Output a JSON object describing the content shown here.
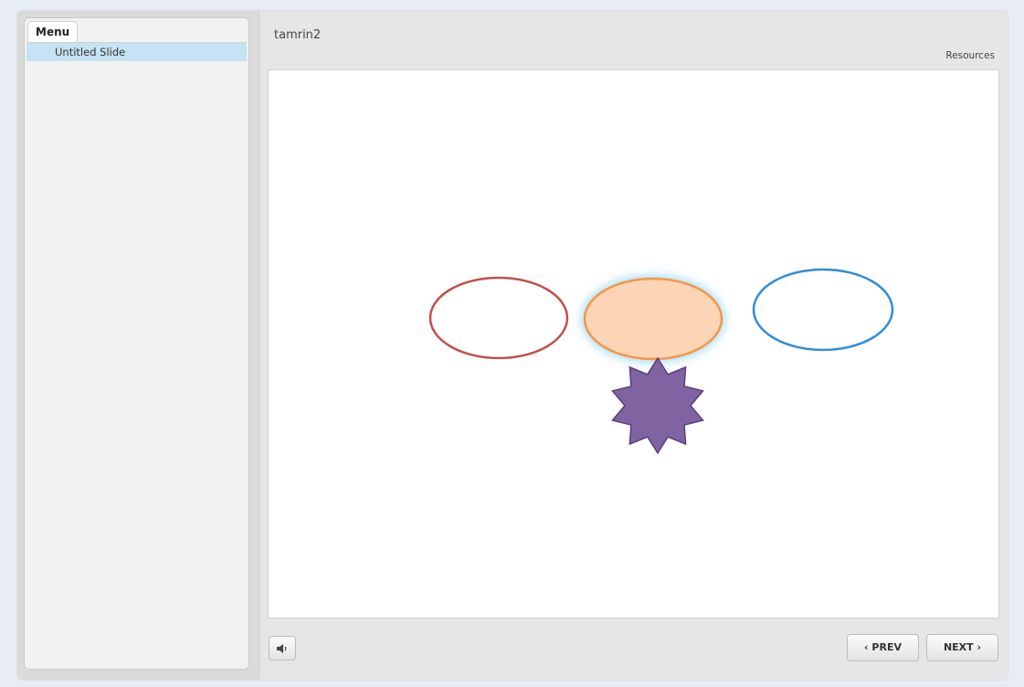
{
  "sidebar": {
    "tab_label": "Menu",
    "items": [
      {
        "label": "Untitled Slide",
        "selected": true
      }
    ]
  },
  "header": {
    "title": "tamrin2",
    "resources_label": "Resources"
  },
  "slide": {
    "shapes": [
      {
        "kind": "ellipse",
        "stroke": "#c0504d",
        "fill": "none"
      },
      {
        "kind": "ellipse",
        "stroke": "#f79646",
        "fill": "#fbd5b5",
        "glow": "#9fdcf7"
      },
      {
        "kind": "ellipse",
        "stroke": "#2f8ddc",
        "fill": "none"
      },
      {
        "kind": "star",
        "points": 10,
        "stroke": "#5c3c7e",
        "fill": "#8064a2"
      }
    ]
  },
  "controls": {
    "audio_icon": "speaker-icon",
    "prev_label": "PREV",
    "next_label": "NEXT",
    "prev_icon": "‹",
    "next_icon": "›"
  }
}
